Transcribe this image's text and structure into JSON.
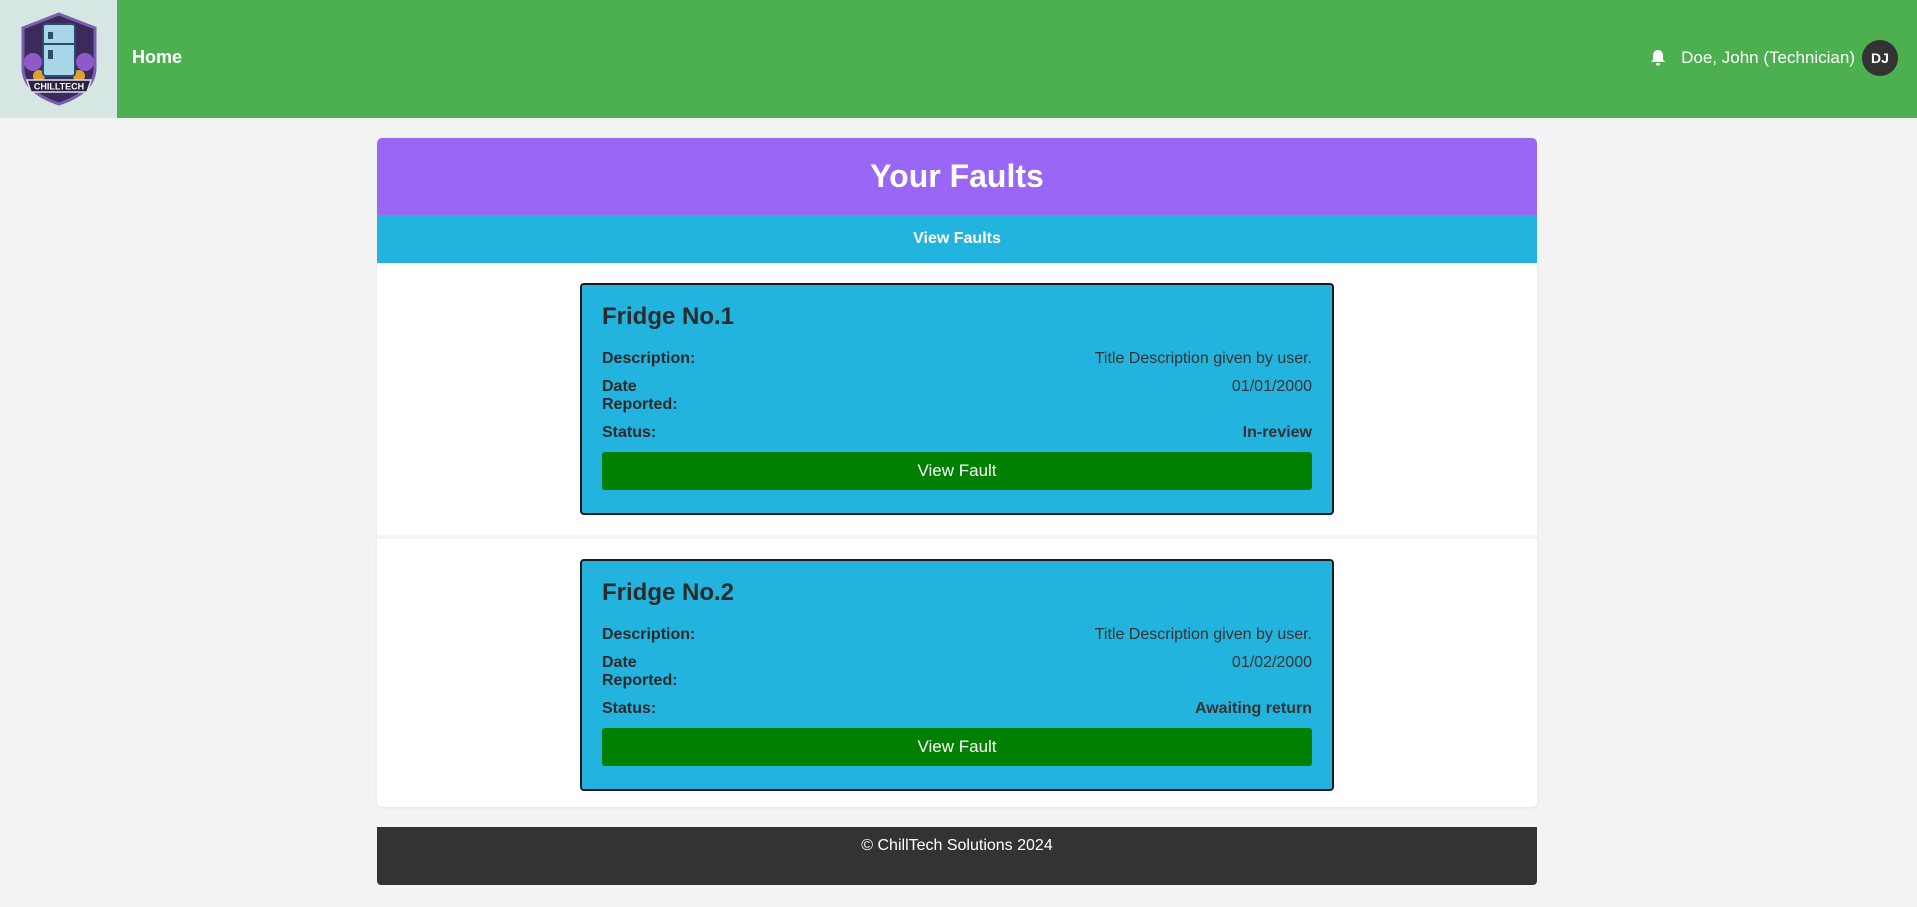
{
  "header": {
    "logo_text": "CHILLTECH",
    "home_label": "Home",
    "notification_icon": "bell-icon",
    "user_name": "Doe, John (Technician)",
    "avatar_initials": "DJ",
    "bg_color": "#4caf50"
  },
  "panel": {
    "title": "Your Faults",
    "subtitle": "View Faults",
    "title_color": "#9966f5",
    "subtitle_color": "#22b4de"
  },
  "faults": [
    {
      "name": "Fridge No.1",
      "description_label": "Description:",
      "description": "Title Description given by user.",
      "date_label": "Date Reported:",
      "date": "01/01/2000",
      "status_label": "Status:",
      "status": "In-review",
      "status_color": "#e8001a",
      "button_label": "View Fault"
    },
    {
      "name": "Fridge No.2",
      "description_label": "Description:",
      "description": "Title Description given by user.",
      "date_label": "Date Reported:",
      "date": "01/02/2000",
      "status_label": "Status:",
      "status": "Awaiting return",
      "status_color": "#7cf23a",
      "button_label": "View Fault"
    }
  ],
  "footer": {
    "text": "© ChillTech Solutions 2024"
  }
}
